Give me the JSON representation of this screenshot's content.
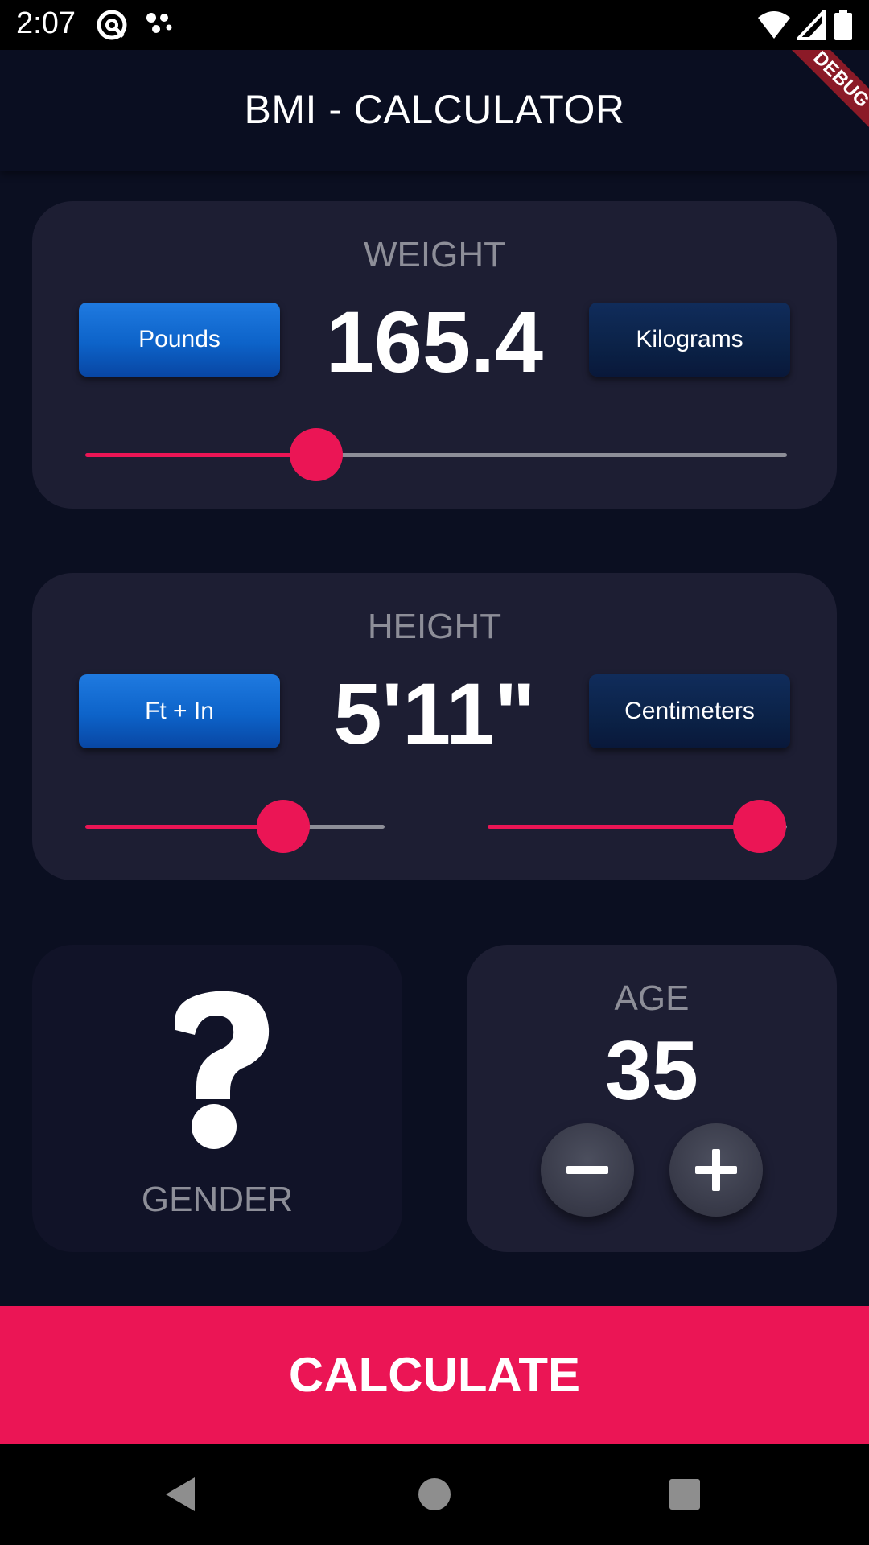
{
  "status_bar": {
    "time": "2:07",
    "icons": [
      "at-sign-icon",
      "dots-icon",
      "wifi-icon",
      "signal-icon",
      "battery-icon"
    ]
  },
  "app_bar": {
    "title": "BMI - CALCULATOR"
  },
  "debug_banner": {
    "text": "DEBUG"
  },
  "weight": {
    "label": "WEIGHT",
    "value": "165.4",
    "unit_left": "Pounds",
    "unit_right": "Kilograms",
    "active_unit": "Pounds",
    "slider_fraction": 0.33
  },
  "height": {
    "label": "HEIGHT",
    "value": "5'11\"",
    "unit_left": "Ft + In",
    "unit_right": "Centimeters",
    "active_unit": "Ft + In",
    "feet_slider_fraction": 0.66,
    "inches_slider_fraction": 0.91
  },
  "gender": {
    "label": "GENDER",
    "icon": "question-mark-icon"
  },
  "age": {
    "label": "AGE",
    "value": "35",
    "minus_icon": "minus-icon",
    "plus_icon": "plus-icon"
  },
  "calculate": {
    "label": "CALCULATE"
  },
  "nav_bar": {
    "icons": [
      "back-icon",
      "home-icon",
      "recents-icon"
    ]
  },
  "colors": {
    "background": "#0b0f21",
    "card": "#1d1e33",
    "accent": "#eb1555",
    "label": "#8d8e98",
    "active_button": "#1f7ae0",
    "inactive_button": "#0b2247"
  }
}
